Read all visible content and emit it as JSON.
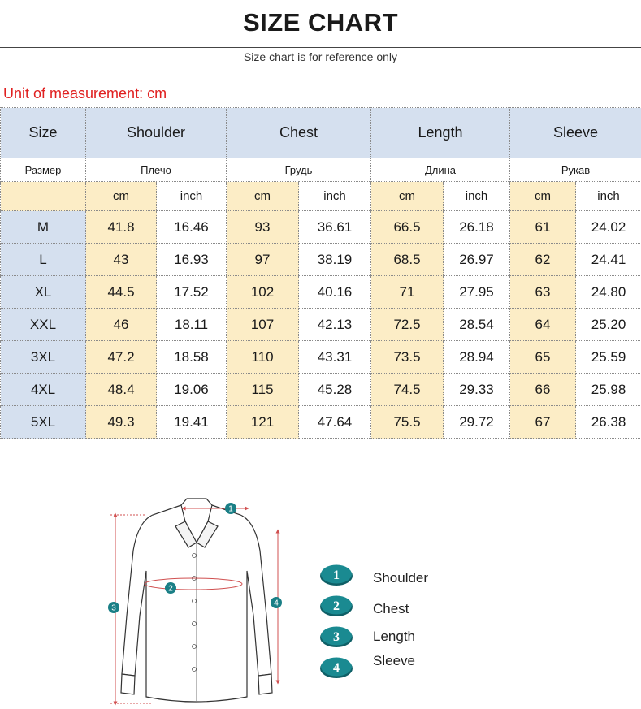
{
  "title": "SIZE CHART",
  "subtitle": "Size chart is for reference only",
  "unit_note": "Unit of measurement: cm",
  "table": {
    "header": [
      "Size",
      "Shoulder",
      "Chest",
      "Length",
      "Sleeve"
    ],
    "header_ru": [
      "Размер",
      "Плечо",
      "Грудь",
      "Длина",
      "Рукав"
    ],
    "units": [
      "cm",
      "inch",
      "cm",
      "inch",
      "cm",
      "inch",
      "cm",
      "inch"
    ],
    "rows": [
      [
        "M",
        "41.8",
        "16.46",
        "93",
        "36.61",
        "66.5",
        "26.18",
        "61",
        "24.02"
      ],
      [
        "L",
        "43",
        "16.93",
        "97",
        "38.19",
        "68.5",
        "26.97",
        "62",
        "24.41"
      ],
      [
        "XL",
        "44.5",
        "17.52",
        "102",
        "40.16",
        "71",
        "27.95",
        "63",
        "24.80"
      ],
      [
        "XXL",
        "46",
        "18.11",
        "107",
        "42.13",
        "72.5",
        "28.54",
        "64",
        "25.20"
      ],
      [
        "3XL",
        "47.2",
        "18.58",
        "110",
        "43.31",
        "73.5",
        "28.94",
        "65",
        "25.59"
      ],
      [
        "4XL",
        "48.4",
        "19.06",
        "115",
        "45.28",
        "74.5",
        "29.33",
        "66",
        "25.98"
      ],
      [
        "5XL",
        "49.3",
        "19.41",
        "121",
        "47.64",
        "75.5",
        "29.72",
        "67",
        "26.38"
      ]
    ]
  },
  "diagram": {
    "markers": [
      "1",
      "2",
      "3",
      "4"
    ],
    "legend": [
      {
        "number": "1",
        "label": "Shoulder"
      },
      {
        "number": "2",
        "label": "Chest"
      },
      {
        "number": "3",
        "label": "Length"
      },
      {
        "number": "4",
        "label": "Sleeve"
      }
    ]
  },
  "colors": {
    "header_bg": "#d5e0ef",
    "cm_bg": "#fcedc6",
    "unit_note": "#e02020",
    "badge": "#1a7f86",
    "measure_line": "#d05050"
  }
}
